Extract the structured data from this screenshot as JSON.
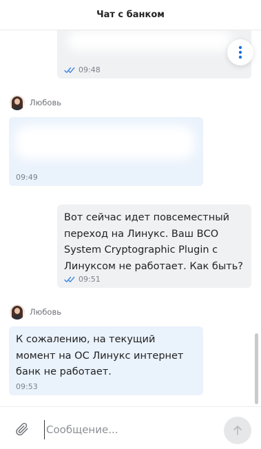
{
  "header": {
    "title": "Чат с банком"
  },
  "messages": [
    {
      "direction": "out",
      "text": "",
      "time": "09:48",
      "status_icon": "double-check-icon"
    },
    {
      "direction": "in",
      "sender": "Любовь",
      "text": "",
      "time": "09:49"
    },
    {
      "direction": "out",
      "text": "Вот сейчас идет повсеместный переход на Линукс. Ваш ВСО System Cryptographic Plugin с Линуксом не работает. Как быть?",
      "time": "09:51",
      "status_icon": "double-check-icon"
    },
    {
      "direction": "in",
      "sender": "Любовь",
      "text": "К сожалению, на текущий момент на ОС Линукс интернет банк не работает.",
      "time": "09:53"
    }
  ],
  "composer": {
    "placeholder": "Сообщение..."
  },
  "icons": {
    "menu": "more-vertical-icon",
    "attach": "paperclip-icon",
    "send": "arrow-up-icon",
    "read": "double-check-icon"
  },
  "colors": {
    "accent": "#1e72d8",
    "outgoing_bubble": "#f0f1f3",
    "incoming_bubble": "#eaf2fc"
  }
}
